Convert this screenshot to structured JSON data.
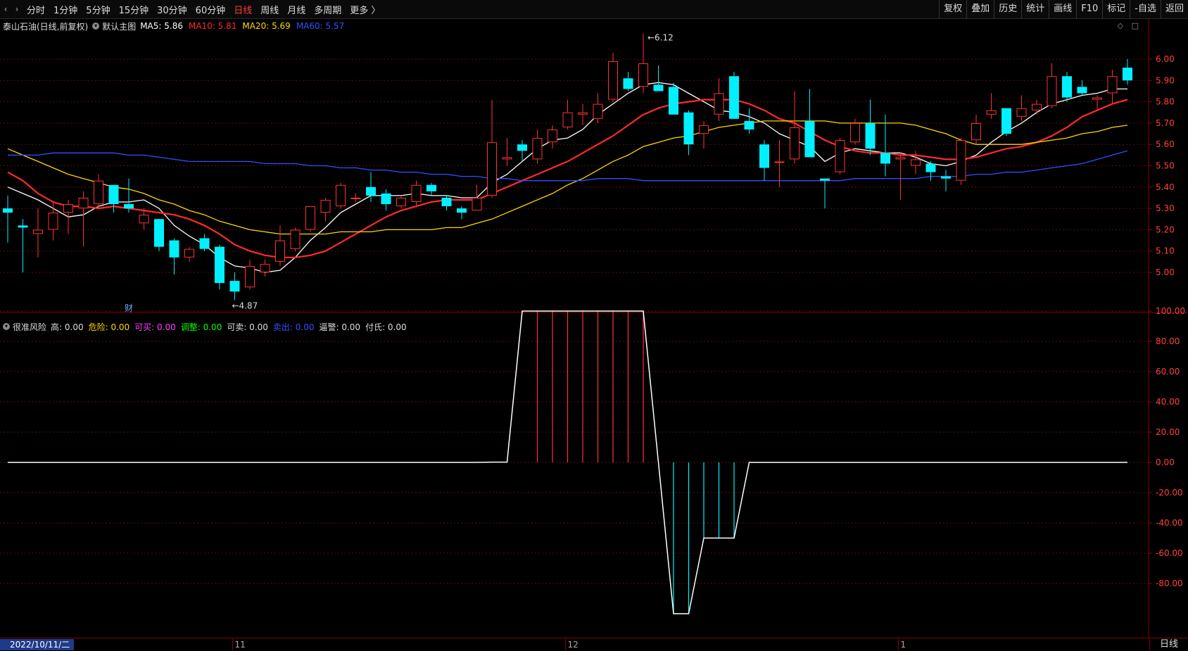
{
  "toolbar": {
    "periods": [
      {
        "label": "分时",
        "active": false
      },
      {
        "label": "1分钟",
        "active": false
      },
      {
        "label": "5分钟",
        "active": false
      },
      {
        "label": "15分钟",
        "active": false
      },
      {
        "label": "30分钟",
        "active": false
      },
      {
        "label": "60分钟",
        "active": false
      },
      {
        "label": "日线",
        "active": true
      },
      {
        "label": "周线",
        "active": false
      },
      {
        "label": "月线",
        "active": false
      },
      {
        "label": "多周期",
        "active": false
      },
      {
        "label": "更多 〉",
        "active": false
      }
    ],
    "right_buttons": [
      "复权",
      "叠加",
      "历史",
      "统计",
      "画线",
      "F10",
      "标记",
      "-自选",
      "返回"
    ]
  },
  "main_legend": {
    "title": "泰山石油(日线,前复权)",
    "template": "默认主图",
    "ma": [
      {
        "label": "MA5: 5.86",
        "color": "#ffffff"
      },
      {
        "label": "MA10: 5.81",
        "color": "#ff2a2a"
      },
      {
        "label": "MA20: 5.69",
        "color": "#ffd700"
      },
      {
        "label": "MA60: 5.57",
        "color": "#3050ff"
      }
    ]
  },
  "sub_legend": {
    "title": "很准风险",
    "items": [
      {
        "label": "高: 0.00",
        "color": "#dddddd"
      },
      {
        "label": "危险: 0.00",
        "color": "#ffd700"
      },
      {
        "label": "可买: 0.00",
        "color": "#ff40ff"
      },
      {
        "label": "调整: 0.00",
        "color": "#00ff00"
      },
      {
        "label": "可卖: 0.00",
        "color": "#dddddd"
      },
      {
        "label": "卖出: 0.00",
        "color": "#3050ff"
      },
      {
        "label": "逼警: 0.00",
        "color": "#dddddd"
      },
      {
        "label": "付氏: 0.00",
        "color": "#dddddd"
      }
    ]
  },
  "annotations": {
    "high": "6.12",
    "low": "4.87",
    "finance_marker": "财"
  },
  "bottom": {
    "date": "2022/10/11/二",
    "months": [
      {
        "label": "11",
        "index": 15
      },
      {
        "label": "12",
        "index": 37
      },
      {
        "label": "1",
        "index": 59
      }
    ],
    "period": "日线"
  },
  "chart_data": [
    {
      "type": "candlestick",
      "title": "泰山石油(日线,前复权)",
      "y_ticks": [
        6.0,
        5.9,
        5.8,
        5.7,
        5.6,
        5.5,
        5.4,
        5.3,
        5.2,
        5.1,
        5.0
      ],
      "ylim": [
        4.85,
        6.12
      ],
      "colors": {
        "up": "#ff3232",
        "down": "#00f0ff",
        "grid": "#5a1010"
      },
      "candles": [
        {
          "o": 5.3,
          "h": 5.36,
          "l": 5.14,
          "c": 5.28
        },
        {
          "o": 5.22,
          "h": 5.25,
          "l": 5.0,
          "c": 5.21
        },
        {
          "o": 5.18,
          "h": 5.3,
          "l": 5.07,
          "c": 5.2
        },
        {
          "o": 5.2,
          "h": 5.33,
          "l": 5.15,
          "c": 5.28
        },
        {
          "o": 5.28,
          "h": 5.34,
          "l": 5.18,
          "c": 5.32
        },
        {
          "o": 5.3,
          "h": 5.38,
          "l": 5.12,
          "c": 5.35
        },
        {
          "o": 5.32,
          "h": 5.46,
          "l": 5.3,
          "c": 5.43
        },
        {
          "o": 5.41,
          "h": 5.41,
          "l": 5.28,
          "c": 5.32
        },
        {
          "o": 5.32,
          "h": 5.44,
          "l": 5.28,
          "c": 5.3
        },
        {
          "o": 5.23,
          "h": 5.3,
          "l": 5.2,
          "c": 5.27
        },
        {
          "o": 5.25,
          "h": 5.25,
          "l": 5.1,
          "c": 5.12
        },
        {
          "o": 5.15,
          "h": 5.16,
          "l": 4.99,
          "c": 5.07
        },
        {
          "o": 5.07,
          "h": 5.12,
          "l": 5.05,
          "c": 5.11
        },
        {
          "o": 5.16,
          "h": 5.18,
          "l": 5.1,
          "c": 5.11
        },
        {
          "o": 5.12,
          "h": 5.13,
          "l": 4.92,
          "c": 4.95
        },
        {
          "o": 4.96,
          "h": 5.0,
          "l": 4.87,
          "c": 4.91
        },
        {
          "o": 4.93,
          "h": 5.06,
          "l": 4.92,
          "c": 5.03
        },
        {
          "o": 5.0,
          "h": 5.06,
          "l": 4.98,
          "c": 5.04
        },
        {
          "o": 5.05,
          "h": 5.22,
          "l": 5.03,
          "c": 5.15
        },
        {
          "o": 5.11,
          "h": 5.21,
          "l": 5.1,
          "c": 5.2
        },
        {
          "o": 5.2,
          "h": 5.31,
          "l": 5.19,
          "c": 5.31
        },
        {
          "o": 5.28,
          "h": 5.35,
          "l": 5.24,
          "c": 5.34
        },
        {
          "o": 5.31,
          "h": 5.42,
          "l": 5.3,
          "c": 5.41
        },
        {
          "o": 5.35,
          "h": 5.37,
          "l": 5.33,
          "c": 5.35
        },
        {
          "o": 5.4,
          "h": 5.47,
          "l": 5.33,
          "c": 5.36
        },
        {
          "o": 5.37,
          "h": 5.39,
          "l": 5.29,
          "c": 5.32
        },
        {
          "o": 5.31,
          "h": 5.36,
          "l": 5.3,
          "c": 5.35
        },
        {
          "o": 5.33,
          "h": 5.43,
          "l": 5.31,
          "c": 5.41
        },
        {
          "o": 5.41,
          "h": 5.42,
          "l": 5.36,
          "c": 5.38
        },
        {
          "o": 5.35,
          "h": 5.36,
          "l": 5.29,
          "c": 5.31
        },
        {
          "o": 5.3,
          "h": 5.31,
          "l": 5.25,
          "c": 5.28
        },
        {
          "o": 5.29,
          "h": 5.41,
          "l": 5.29,
          "c": 5.35
        },
        {
          "o": 5.36,
          "h": 5.81,
          "l": 5.35,
          "c": 5.61
        },
        {
          "o": 5.53,
          "h": 5.63,
          "l": 5.5,
          "c": 5.54
        },
        {
          "o": 5.6,
          "h": 5.62,
          "l": 5.52,
          "c": 5.57
        },
        {
          "o": 5.53,
          "h": 5.67,
          "l": 5.51,
          "c": 5.63
        },
        {
          "o": 5.61,
          "h": 5.69,
          "l": 5.58,
          "c": 5.67
        },
        {
          "o": 5.68,
          "h": 5.81,
          "l": 5.67,
          "c": 5.75
        },
        {
          "o": 5.74,
          "h": 5.79,
          "l": 5.69,
          "c": 5.75
        },
        {
          "o": 5.72,
          "h": 5.84,
          "l": 5.7,
          "c": 5.79
        },
        {
          "o": 5.81,
          "h": 6.03,
          "l": 5.8,
          "c": 5.99
        },
        {
          "o": 5.91,
          "h": 5.94,
          "l": 5.85,
          "c": 5.86
        },
        {
          "o": 5.87,
          "h": 6.12,
          "l": 5.84,
          "c": 5.98
        },
        {
          "o": 5.88,
          "h": 5.97,
          "l": 5.85,
          "c": 5.85
        },
        {
          "o": 5.87,
          "h": 5.89,
          "l": 5.76,
          "c": 5.74
        },
        {
          "o": 5.75,
          "h": 5.76,
          "l": 5.55,
          "c": 5.6
        },
        {
          "o": 5.65,
          "h": 5.71,
          "l": 5.58,
          "c": 5.69
        },
        {
          "o": 5.74,
          "h": 5.91,
          "l": 5.71,
          "c": 5.84
        },
        {
          "o": 5.92,
          "h": 5.94,
          "l": 5.72,
          "c": 5.72
        },
        {
          "o": 5.71,
          "h": 5.77,
          "l": 5.65,
          "c": 5.67
        },
        {
          "o": 5.6,
          "h": 5.62,
          "l": 5.43,
          "c": 5.49
        },
        {
          "o": 5.52,
          "h": 5.62,
          "l": 5.4,
          "c": 5.52
        },
        {
          "o": 5.53,
          "h": 5.85,
          "l": 5.51,
          "c": 5.68
        },
        {
          "o": 5.71,
          "h": 5.86,
          "l": 5.58,
          "c": 5.54
        },
        {
          "o": 5.44,
          "h": 5.44,
          "l": 5.3,
          "c": 5.43
        },
        {
          "o": 5.47,
          "h": 5.63,
          "l": 5.46,
          "c": 5.62
        },
        {
          "o": 5.61,
          "h": 5.72,
          "l": 5.6,
          "c": 5.7
        },
        {
          "o": 5.7,
          "h": 5.81,
          "l": 5.55,
          "c": 5.58
        },
        {
          "o": 5.56,
          "h": 5.74,
          "l": 5.45,
          "c": 5.51
        },
        {
          "o": 5.53,
          "h": 5.56,
          "l": 5.34,
          "c": 5.54
        },
        {
          "o": 5.5,
          "h": 5.57,
          "l": 5.46,
          "c": 5.53
        },
        {
          "o": 5.51,
          "h": 5.52,
          "l": 5.43,
          "c": 5.47
        },
        {
          "o": 5.45,
          "h": 5.48,
          "l": 5.38,
          "c": 5.44
        },
        {
          "o": 5.43,
          "h": 5.63,
          "l": 5.41,
          "c": 5.62
        },
        {
          "o": 5.62,
          "h": 5.74,
          "l": 5.6,
          "c": 5.7
        },
        {
          "o": 5.74,
          "h": 5.84,
          "l": 5.72,
          "c": 5.76
        },
        {
          "o": 5.77,
          "h": 5.77,
          "l": 5.64,
          "c": 5.65
        },
        {
          "o": 5.73,
          "h": 5.83,
          "l": 5.71,
          "c": 5.77
        },
        {
          "o": 5.76,
          "h": 5.81,
          "l": 5.74,
          "c": 5.79
        },
        {
          "o": 5.78,
          "h": 5.98,
          "l": 5.77,
          "c": 5.92
        },
        {
          "o": 5.92,
          "h": 5.94,
          "l": 5.8,
          "c": 5.82
        },
        {
          "o": 5.87,
          "h": 5.9,
          "l": 5.83,
          "c": 5.84
        },
        {
          "o": 5.81,
          "h": 5.83,
          "l": 5.76,
          "c": 5.82
        },
        {
          "o": 5.84,
          "h": 5.95,
          "l": 5.79,
          "c": 5.92
        },
        {
          "o": 5.96,
          "h": 6.0,
          "l": 5.88,
          "c": 5.9
        }
      ],
      "series": [
        {
          "name": "MA5",
          "color": "#ffffff",
          "values": [
            5.4,
            5.37,
            5.34,
            5.3,
            5.26,
            5.27,
            5.31,
            5.33,
            5.33,
            5.34,
            5.3,
            5.22,
            5.17,
            5.13,
            5.07,
            5.03,
            5.02,
            5.0,
            5.01,
            5.07,
            5.15,
            5.21,
            5.28,
            5.32,
            5.36,
            5.36,
            5.36,
            5.37,
            5.36,
            5.36,
            5.35,
            5.35,
            5.42,
            5.46,
            5.52,
            5.58,
            5.62,
            5.63,
            5.67,
            5.74,
            5.79,
            5.84,
            5.88,
            5.89,
            5.88,
            5.84,
            5.8,
            5.76,
            5.75,
            5.73,
            5.7,
            5.65,
            5.62,
            5.59,
            5.52,
            5.56,
            5.58,
            5.57,
            5.56,
            5.56,
            5.54,
            5.51,
            5.5,
            5.52,
            5.55,
            5.61,
            5.66,
            5.7,
            5.75,
            5.79,
            5.81,
            5.83,
            5.84,
            5.86,
            5.86
          ]
        },
        {
          "name": "MA10",
          "color": "#ff2a2a",
          "values": [
            5.47,
            5.43,
            5.37,
            5.33,
            5.31,
            5.31,
            5.3,
            5.31,
            5.3,
            5.29,
            5.28,
            5.27,
            5.25,
            5.22,
            5.18,
            5.13,
            5.1,
            5.08,
            5.07,
            5.07,
            5.08,
            5.1,
            5.14,
            5.18,
            5.22,
            5.26,
            5.29,
            5.31,
            5.33,
            5.34,
            5.34,
            5.34,
            5.37,
            5.4,
            5.43,
            5.46,
            5.49,
            5.52,
            5.56,
            5.6,
            5.64,
            5.69,
            5.74,
            5.77,
            5.79,
            5.8,
            5.81,
            5.81,
            5.81,
            5.79,
            5.76,
            5.72,
            5.7,
            5.66,
            5.62,
            5.59,
            5.57,
            5.56,
            5.56,
            5.55,
            5.55,
            5.54,
            5.53,
            5.53,
            5.54,
            5.56,
            5.58,
            5.59,
            5.61,
            5.64,
            5.68,
            5.73,
            5.76,
            5.79,
            5.81
          ]
        },
        {
          "name": "MA20",
          "color": "#ffd700",
          "values": [
            5.58,
            5.55,
            5.52,
            5.49,
            5.46,
            5.44,
            5.42,
            5.4,
            5.39,
            5.37,
            5.34,
            5.32,
            5.29,
            5.27,
            5.24,
            5.22,
            5.2,
            5.19,
            5.18,
            5.18,
            5.18,
            5.18,
            5.19,
            5.19,
            5.19,
            5.2,
            5.2,
            5.2,
            5.2,
            5.21,
            5.21,
            5.23,
            5.25,
            5.28,
            5.31,
            5.34,
            5.37,
            5.41,
            5.44,
            5.48,
            5.52,
            5.55,
            5.59,
            5.61,
            5.63,
            5.64,
            5.66,
            5.68,
            5.69,
            5.7,
            5.71,
            5.71,
            5.71,
            5.71,
            5.71,
            5.7,
            5.7,
            5.7,
            5.7,
            5.7,
            5.69,
            5.67,
            5.65,
            5.62,
            5.6,
            5.6,
            5.6,
            5.6,
            5.61,
            5.62,
            5.63,
            5.65,
            5.66,
            5.68,
            5.69
          ]
        },
        {
          "name": "MA60",
          "color": "#3050ff",
          "values": [
            5.55,
            5.55,
            5.55,
            5.56,
            5.56,
            5.56,
            5.56,
            5.56,
            5.55,
            5.55,
            5.54,
            5.53,
            5.52,
            5.52,
            5.52,
            5.52,
            5.52,
            5.51,
            5.51,
            5.51,
            5.5,
            5.5,
            5.49,
            5.49,
            5.48,
            5.48,
            5.47,
            5.47,
            5.46,
            5.46,
            5.45,
            5.45,
            5.44,
            5.44,
            5.43,
            5.43,
            5.43,
            5.43,
            5.43,
            5.44,
            5.44,
            5.44,
            5.43,
            5.43,
            5.43,
            5.43,
            5.43,
            5.43,
            5.43,
            5.43,
            5.43,
            5.43,
            5.43,
            5.43,
            5.43,
            5.43,
            5.44,
            5.44,
            5.44,
            5.44,
            5.44,
            5.45,
            5.45,
            5.45,
            5.46,
            5.46,
            5.47,
            5.47,
            5.48,
            5.49,
            5.5,
            5.51,
            5.53,
            5.55,
            5.57
          ]
        }
      ]
    },
    {
      "type": "line",
      "title": "很准风险",
      "y_ticks": [
        100.0,
        80.0,
        60.0,
        40.0,
        20.0,
        0.0,
        -20.0,
        -40.0,
        -60.0,
        -80.0
      ],
      "ylim": [
        -100,
        100
      ],
      "series": [
        {
          "name": "",
          "color": "#ffffff",
          "values": [
            0,
            0,
            0,
            0,
            0,
            0,
            0,
            0,
            0,
            0,
            0,
            0,
            0,
            0,
            0,
            0,
            0,
            0,
            0,
            0,
            0,
            0,
            0,
            0,
            0,
            0,
            0,
            0,
            0,
            0,
            0,
            0,
            0.2,
            0.2,
            100,
            100,
            100,
            100,
            100,
            100,
            100,
            100,
            100,
            0,
            -100,
            -100,
            -50,
            -50,
            -50,
            0,
            0,
            0,
            0,
            0,
            0,
            0,
            0,
            0,
            0,
            0,
            0,
            0,
            0,
            0,
            0,
            0,
            0,
            0,
            0,
            0,
            0,
            0,
            0,
            0,
            0
          ]
        }
      ],
      "bars": [
        {
          "index": 35,
          "value": 100,
          "color": "#ff3232"
        },
        {
          "index": 36,
          "value": 100,
          "color": "#ff3232"
        },
        {
          "index": 37,
          "value": 100,
          "color": "#ff3232"
        },
        {
          "index": 38,
          "value": 100,
          "color": "#ff3232"
        },
        {
          "index": 39,
          "value": 100,
          "color": "#ff3232"
        },
        {
          "index": 40,
          "value": 100,
          "color": "#ff3232"
        },
        {
          "index": 41,
          "value": 100,
          "color": "#ff3232"
        },
        {
          "index": 42,
          "value": 100,
          "color": "#ff3232"
        },
        {
          "index": 44,
          "value": -100,
          "color": "#00f0ff"
        },
        {
          "index": 45,
          "value": -100,
          "color": "#00f0ff"
        },
        {
          "index": 46,
          "value": -50,
          "color": "#00f0ff"
        },
        {
          "index": 47,
          "value": -50,
          "color": "#00f0ff"
        },
        {
          "index": 48,
          "value": -50,
          "color": "#00f0ff"
        }
      ]
    }
  ]
}
